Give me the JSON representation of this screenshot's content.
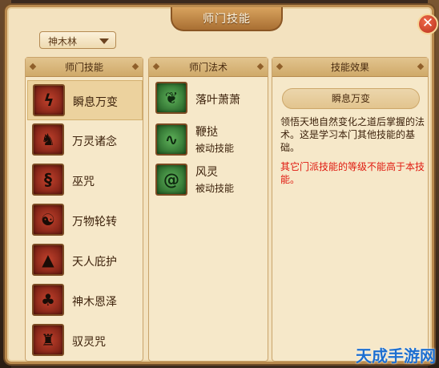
{
  "window": {
    "title": "师门技能"
  },
  "faction_dropdown": {
    "value": "神木林"
  },
  "panels": {
    "skills_header": "师门技能",
    "arts_header": "师门法术",
    "effect_header": "技能效果"
  },
  "skills": [
    {
      "name": "瞬息万变",
      "icon": "lightning-icon",
      "selected": true
    },
    {
      "name": "万灵诸念",
      "icon": "spirit-beast-icon",
      "selected": false
    },
    {
      "name": "巫咒",
      "icon": "curse-sigil-icon",
      "selected": false
    },
    {
      "name": "万物轮转",
      "icon": "yin-yang-icon",
      "selected": false
    },
    {
      "name": "天人庇护",
      "icon": "praying-hands-icon",
      "selected": false
    },
    {
      "name": "神木恩泽",
      "icon": "tree-icon",
      "selected": false
    },
    {
      "name": "驭灵咒",
      "icon": "spirit-figure-icon",
      "selected": false
    }
  ],
  "arts": [
    {
      "name": "落叶萧萧",
      "sub": "",
      "icon": "falling-leaf-icon"
    },
    {
      "name": "鞭挞",
      "sub": "被动技能",
      "icon": "vine-whip-icon"
    },
    {
      "name": "风灵",
      "sub": "被动技能",
      "icon": "whirlwind-icon"
    }
  ],
  "effect": {
    "skill_name": "瞬息万变",
    "description": "领悟天地自然变化之道后掌握的法术。这是学习本门其他技能的基础。",
    "warning": "其它门派技能的等级不能高于本技能。"
  },
  "watermark": "天成手游网",
  "colors": {
    "warning": "#e01a10",
    "accent": "#b98a4e"
  }
}
